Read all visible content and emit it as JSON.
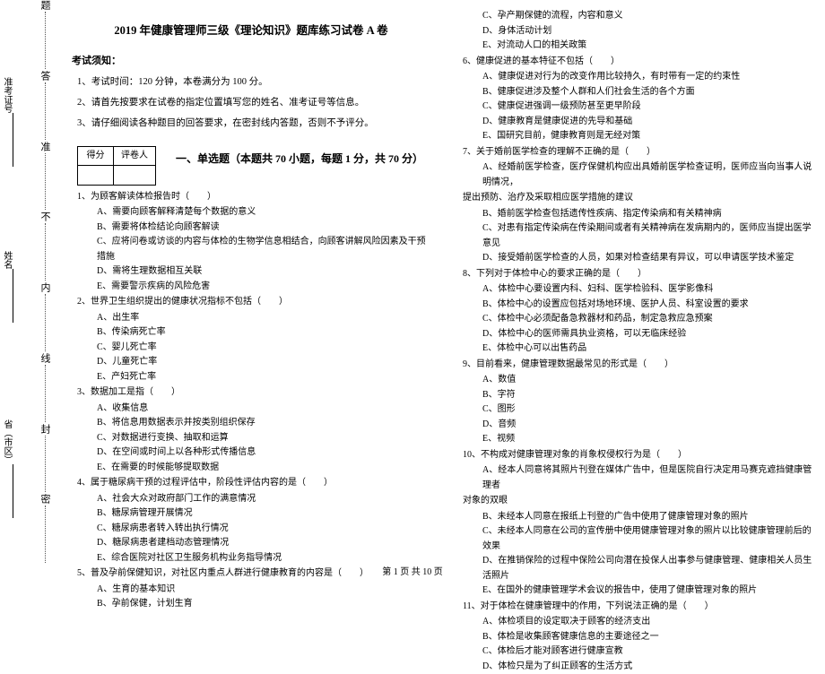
{
  "side": {
    "l1": "省（市区）",
    "l2": "姓名",
    "l3": "准考证号"
  },
  "binding": {
    "m1": "密",
    "m2": "封",
    "m3": "线",
    "m4": "内",
    "m5": "不",
    "m6": "准",
    "m7": "答",
    "m8": "题"
  },
  "title": "2019 年健康管理师三级《理论知识》题库练习试卷 A 卷",
  "notice_head": "考试须知：",
  "notice1": "1、考试时间：120 分钟，本卷满分为 100 分。",
  "notice2": "2、请首先按要求在试卷的指定位置填写您的姓名、准考证号等信息。",
  "notice3": "3、请仔细阅读各种题目的回答要求，在密封线内答题，否则不予评分。",
  "scorebox": {
    "c1": "得分",
    "c2": "评卷人"
  },
  "part1": "一、单选题（本题共 70 小题，每题 1 分，共 70 分）",
  "q1": {
    "stem": "1、为顾客解读体检报告时（　　）",
    "A": "A、需要向顾客解释清楚每个数据的意义",
    "B": "B、需要将体检结论向顾客解读",
    "C": "C、应将问卷或访谈的内容与体检的生物学信息相结合，向顾客讲解风险因素及干预措施",
    "D": "D、需将生理数据相互关联",
    "E": "E、需要警示疾病的风险危害"
  },
  "q2": {
    "stem": "2、世界卫生组织提出的健康状况指标不包括（　　）",
    "A": "A、出生率",
    "B": "B、传染病死亡率",
    "C": "C、婴儿死亡率",
    "D": "D、儿童死亡率",
    "E": "E、产妇死亡率"
  },
  "q3": {
    "stem": "3、数据加工是指（　　）",
    "A": "A、收集信息",
    "B": "B、将信息用数据表示并按类别组织保存",
    "C": "C、对数据进行变换、抽取和运算",
    "D": "D、在空间或时间上以各种形式传播信息",
    "E": "E、在需要的时候能够提取数据"
  },
  "q4": {
    "stem": "4、属于糖尿病干预的过程评估中，阶段性评估内容的是（　　）",
    "A": "A、社会大众对政府部门工作的满意情况",
    "B": "B、糖尿病管理开展情况",
    "C": "C、糖尿病患者转入转出执行情况",
    "D": "D、糖尿病患者建档动态管理情况",
    "E": "E、综合医院对社区卫生服务机构业务指导情况"
  },
  "q5": {
    "stem": "5、普及孕前保健知识，对社区内重点人群进行健康教育的内容是（　　）",
    "A": "A、生育的基本知识",
    "B": "B、孕前保健，计划生育"
  },
  "q5r": {
    "C": "C、孕产期保健的流程，内容和意义",
    "D": "D、身体活动计划",
    "E": "E、对流动人口的相关政策"
  },
  "q6": {
    "stem": "6、健康促进的基本特征不包括（　　）",
    "A": "A、健康促进对行为的改变作用比较持久，有时带有一定的约束性",
    "B": "B、健康促进涉及整个人群和人们社会生活的各个方面",
    "C": "C、健康促进强调一级预防甚至更早阶段",
    "D": "D、健康教育是健康促进的先导和基础",
    "E": "E、国研究目前，健康教育则是无经对策"
  },
  "q7": {
    "stem": "7、关于婚前医学检查的理解不正确的是（　　）",
    "A": "A、经婚前医学检查，医疗保健机构应出具婚前医学检查证明，医师应当向当事人说明情况，",
    "A2": "提出预防、治疗及采取相应医学措施的建议",
    "B": "B、婚前医学检查包括遗传性疾病、指定传染病和有关精神病",
    "C": "C、对患有指定传染病在传染期间或者有关精神病在发病期内的，医师应当提出医学意见",
    "D": "D、接受婚前医学检查的人员，如果对检查结果有异议，可以申请医学技术鉴定"
  },
  "q8": {
    "stem": "8、下列对于体检中心的要求正确的是（　　）",
    "A": "A、体检中心要设置内科、妇科、医学检验科、医学影像科",
    "B": "B、体检中心的设置应包括对场地环境、医护人员、科室设置的要求",
    "C": "C、体检中心必须配备急救器材和药品，制定急救应急预案",
    "D": "D、体检中心的医师需具执业资格，可以无临床经验",
    "E": "E、体检中心可以出售药品"
  },
  "q9": {
    "stem": "9、目前看来，健康管理数据最常见的形式是（　　）",
    "A": "A、数值",
    "B": "B、字符",
    "C": "C、图形",
    "D": "D、音频",
    "E": "E、视频"
  },
  "q10": {
    "stem": "10、不构成对健康管理对象的肖象权侵权行为是（　　）",
    "A": "A、经本人同意将其照片刊登在媒体广告中，但是医院自行决定用马赛克遮挡健康管理者",
    "A2": "对象的双眼",
    "B": "B、未经本人同意在报纸上刊登的广告中使用了健康管理对象的照片",
    "C": "C、未经本人同意在公司的宣传册中使用健康管理对象的照片以比较健康管理前后的效果",
    "D": "D、在推销保险的过程中保险公司向潜在投保人出事参与健康管理、健康相关人员生活照片",
    "E": "E、在国外的健康管理学术会议的报告中，使用了健康管理对象的照片"
  },
  "q11": {
    "stem": "11、对于体检在健康管理中的作用，下列说法正确的是（　　）",
    "A": "A、体检项目的设定取决于顾客的经济支出",
    "B": "B、体检是收集顾客健康信息的主要途径之一",
    "C": "C、体检后才能对顾客进行健康宣教",
    "D": "D、体检只是为了纠正顾客的生活方式"
  },
  "footer": "第 1 页 共 10 页"
}
